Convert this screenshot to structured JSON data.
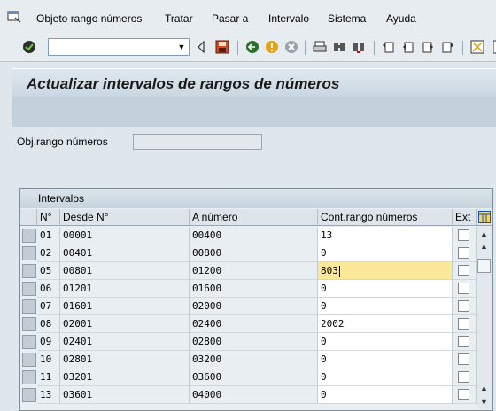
{
  "menu": {
    "items": [
      "Objeto rango números",
      "Tratar",
      "Pasar a",
      "Intervalo",
      "Sistema",
      "Ayuda"
    ]
  },
  "toolbar": {
    "command_value": "",
    "icons": [
      "enter-icon",
      "back-icon",
      "exit-icon",
      "cancel-icon",
      "print-icon",
      "find-icon",
      "find-next-icon",
      "first-page-icon",
      "previous-page-icon",
      "next-page-icon",
      "last-page-icon",
      "create-session-icon"
    ]
  },
  "page": {
    "title": "Actualizar intervalos de rangos de números"
  },
  "form": {
    "obj_label": "Obj.rango números",
    "obj_value": ""
  },
  "table": {
    "title": "Intervalos",
    "headers": [
      "N°",
      "Desde N°",
      "A número",
      "Cont.rango números",
      "Ext"
    ],
    "rows": [
      {
        "n": "01",
        "desde": "00001",
        "a": "00400",
        "cont": "13"
      },
      {
        "n": "02",
        "desde": "00401",
        "a": "00800",
        "cont": "0"
      },
      {
        "n": "05",
        "desde": "00801",
        "a": "01200",
        "cont": "803"
      },
      {
        "n": "06",
        "desde": "01201",
        "a": "01600",
        "cont": "0"
      },
      {
        "n": "07",
        "desde": "01601",
        "a": "02000",
        "cont": "0"
      },
      {
        "n": "08",
        "desde": "02001",
        "a": "02400",
        "cont": "2002"
      },
      {
        "n": "09",
        "desde": "02401",
        "a": "02800",
        "cont": "0"
      },
      {
        "n": "10",
        "desde": "02801",
        "a": "03200",
        "cont": "0"
      },
      {
        "n": "11",
        "desde": "03201",
        "a": "03600",
        "cont": "0"
      },
      {
        "n": "13",
        "desde": "03601",
        "a": "04000",
        "cont": "0"
      }
    ],
    "active_row": 2
  },
  "colors": {
    "active_cell": "#fce899",
    "title_text": "#1a1a1a"
  }
}
